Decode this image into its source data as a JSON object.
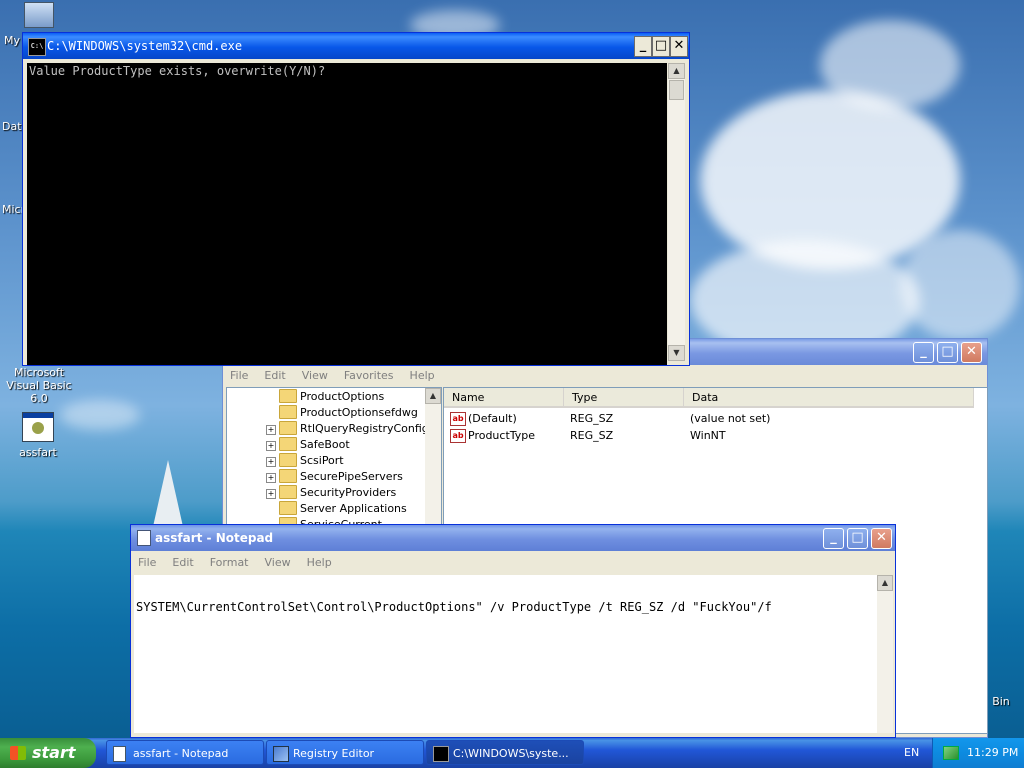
{
  "desktop": {
    "icons": [
      {
        "label": "My",
        "icon": "computer-icon"
      },
      {
        "label": "Dat",
        "icon": "database-icon"
      },
      {
        "label": "Micro",
        "icon": "app-icon"
      },
      {
        "label": "Microsoft Visual Basic 6.0",
        "icon": "visual-basic-icon"
      },
      {
        "label": "assfart",
        "icon": "batch-file-icon"
      },
      {
        "label": "Bin",
        "icon": "recycle-bin-icon"
      }
    ]
  },
  "cmd": {
    "title": "C:\\WINDOWS\\system32\\cmd.exe",
    "output": "Value ProductType exists, overwrite(Y/N)?"
  },
  "regedit": {
    "menu": [
      "File",
      "Edit",
      "View",
      "Favorites",
      "Help"
    ],
    "tree": [
      {
        "label": "ProductOptions",
        "expandable": false
      },
      {
        "label": "ProductOptionsefdwg",
        "expandable": false
      },
      {
        "label": "RtlQueryRegistryConfig",
        "expandable": true
      },
      {
        "label": "SafeBoot",
        "expandable": true
      },
      {
        "label": "ScsiPort",
        "expandable": true
      },
      {
        "label": "SecurePipeServers",
        "expandable": true
      },
      {
        "label": "SecurityProviders",
        "expandable": true
      },
      {
        "label": "Server Applications",
        "expandable": false
      },
      {
        "label": "ServiceCurrent",
        "expandable": false
      }
    ],
    "columns": [
      "Name",
      "Type",
      "Data"
    ],
    "values": [
      {
        "name": "(Default)",
        "type": "REG_SZ",
        "data": "(value not set)"
      },
      {
        "name": "ProductType",
        "type": "REG_SZ",
        "data": "WinNT"
      }
    ]
  },
  "notepad": {
    "title": "assfart - Notepad",
    "menu": [
      "File",
      "Edit",
      "Format",
      "View",
      "Help"
    ],
    "text": "SYSTEM\\CurrentControlSet\\Control\\ProductOptions\" /v ProductType /t REG_SZ /d \"FuckYou\"/f"
  },
  "taskbar": {
    "start_label": "start",
    "items": [
      {
        "label": "assfart - Notepad",
        "icon": "notepad-icon"
      },
      {
        "label": "Registry Editor",
        "icon": "regedit-icon"
      },
      {
        "label": "C:\\WINDOWS\\syste...",
        "icon": "cmd-icon"
      }
    ],
    "language": "EN",
    "clock": "11:29 PM"
  },
  "colors": {
    "title_active": "#0a5ef5",
    "console_bg": "#000000",
    "console_fg": "#c0c0c0",
    "start_green": "#3c9a3c"
  }
}
